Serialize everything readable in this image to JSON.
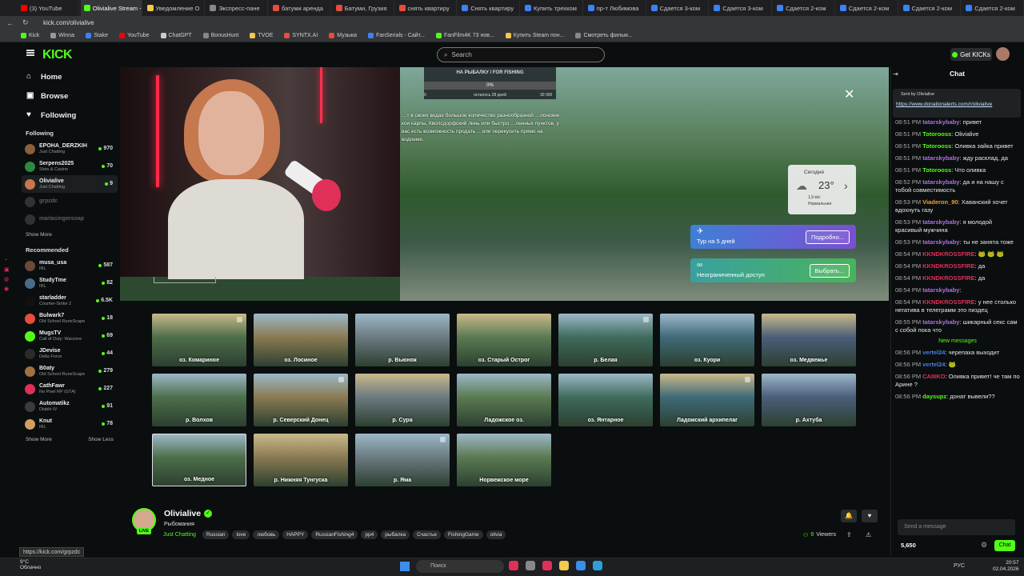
{
  "browser": {
    "tabs": [
      {
        "label": "(3) YouTube",
        "color": "#ff0000"
      },
      {
        "label": "Olivialive Stream - Wa",
        "color": "#53fc18",
        "active": true
      },
      {
        "label": "Уведомление О",
        "color": "#f2c94c"
      },
      {
        "label": "Экспресс-пане",
        "color": "#888888"
      },
      {
        "label": "батуми аренда",
        "color": "#e74c3c"
      },
      {
        "label": "Батуми, Грузия",
        "color": "#e74c3c"
      },
      {
        "label": "снять квартиру",
        "color": "#e74c3c"
      },
      {
        "label": "Снять квартиру",
        "color": "#3b82f6"
      },
      {
        "label": "Купить трехком",
        "color": "#3b82f6"
      },
      {
        "label": "пр-т Любимова",
        "color": "#3b82f6"
      },
      {
        "label": "Сдается 3-ком",
        "color": "#3b82f6"
      },
      {
        "label": "Сдается 3-ком",
        "color": "#3b82f6"
      },
      {
        "label": "Сдается 2-ком",
        "color": "#3b82f6"
      },
      {
        "label": "Сдается 2-ком",
        "color": "#3b82f6"
      },
      {
        "label": "Сдается 2-ком",
        "color": "#3b82f6"
      },
      {
        "label": "Сдается 2-ком",
        "color": "#3b82f6"
      }
    ],
    "url": "kick.com/olivialive",
    "bookmarks": [
      {
        "label": "Kick",
        "color": "#53fc18"
      },
      {
        "label": "Winna",
        "color": "#999999"
      },
      {
        "label": "Stake",
        "color": "#3b82f6"
      },
      {
        "label": "YouTube",
        "color": "#ff0000"
      },
      {
        "label": "ChatGPT",
        "color": "#cccccc"
      },
      {
        "label": "BonusHunt",
        "color": "#888888"
      },
      {
        "label": "TVOE",
        "color": "#f2c94c"
      },
      {
        "label": "SYNTX.AI",
        "color": "#e74c3c"
      },
      {
        "label": "Музыка",
        "color": "#e74c3c"
      },
      {
        "label": "FanSerials - Сайт...",
        "color": "#3b82f6"
      },
      {
        "label": "FanFilm4K 73 нов...",
        "color": "#53fc18"
      },
      {
        "label": "Купить Steam пон...",
        "color": "#f2c94c"
      },
      {
        "label": "Смотреть фильм...",
        "color": "#888888"
      }
    ],
    "hover_url": "https://kick.com/grpzdc"
  },
  "header": {
    "logo": "KICK",
    "search_placeholder": "Search",
    "get_kicks": "Get KICKs"
  },
  "sidebar": {
    "nav": [
      {
        "label": "Home",
        "icon": "⌂"
      },
      {
        "label": "Browse",
        "icon": "▣"
      },
      {
        "label": "Following",
        "icon": "♥"
      }
    ],
    "following_title": "Following",
    "following": [
      {
        "name": "EPOHA_DERZKIH",
        "cat": "Just Chatting",
        "viewers": "970",
        "color": "#8b5e3c"
      },
      {
        "name": "Serpens2025",
        "cat": "Slots & Casino",
        "viewers": "70",
        "color": "#2d8a3e"
      },
      {
        "name": "Olivialive",
        "cat": "Just Chatting",
        "viewers": "9",
        "color": "#c6784e"
      },
      {
        "name": "grpzdc",
        "cat": "",
        "viewers": "",
        "color": "#777777"
      },
      {
        "name": "marlasingersoap",
        "cat": "",
        "viewers": "",
        "color": "#777777"
      }
    ],
    "show_more": "Show More",
    "recommended_title": "Recommended",
    "recommended": [
      {
        "name": "musa_usa",
        "cat": "IRL",
        "viewers": "587",
        "color": "#6b4a3a"
      },
      {
        "name": "StudyTme",
        "cat": "IRL",
        "viewers": "82",
        "color": "#4a6b8a"
      },
      {
        "name": "starladder",
        "cat": "Counter-Strike 2",
        "viewers": "6.5K",
        "color": "#111111"
      },
      {
        "name": "Bulwark7",
        "cat": "Old School RuneScape",
        "viewers": "18",
        "color": "#e74c3c"
      },
      {
        "name": "MugsTV",
        "cat": "Call of Duty: Warzone",
        "viewers": "69",
        "color": "#53fc18"
      },
      {
        "name": "JDevise",
        "cat": "Delta Force",
        "viewers": "44",
        "color": "#2b2b2b"
      },
      {
        "name": "B0aty",
        "cat": "Old School RuneScape",
        "viewers": "279",
        "color": "#a07040"
      },
      {
        "name": "CathFawr",
        "cat": "No Pixel RP (GTA)",
        "viewers": "227",
        "color": "#e0305a"
      },
      {
        "name": "Automatikz",
        "cat": "Diablo IV",
        "viewers": "91",
        "color": "#3b3b3b"
      },
      {
        "name": "Knut",
        "cat": "IRL",
        "viewers": "78",
        "color": "#d0a060"
      }
    ],
    "show_more2": "Show More",
    "show_less": "Show Less"
  },
  "stream": {
    "progress_title": "НА РЫБАЛКУ / FOR FISHING",
    "progress_pct": "0%",
    "progress_left": "осталось 28 дней",
    "progress_min": "0",
    "progress_max": "30 000",
    "game_text": "…т в своих водах большое количество разнообразной …понские кои карпы, Кволсдорфский линь или быстро …ленных пунктов, у вас есть возможность продать …или перекусить прямо на водоеме.",
    "weather": {
      "day": "Сегодня",
      "temp": "23°",
      "wind": "1,9 м/с",
      "pressure": "Нормальная"
    },
    "promo1": {
      "text": "Тур на 5 дней",
      "button": "Подробно..."
    },
    "promo2": {
      "text": "Неограниченный доступ",
      "button": "Выбрать..."
    },
    "locations": [
      "оз. Комариное",
      "оз. Лосиное",
      "р. Вьюнок",
      "оз. Старый Острог",
      "р. Белая",
      "оз. Куори",
      "оз. Медвежье",
      "р. Волхов",
      "р. Северский Донец",
      "р. Сура",
      "Ладожское оз.",
      "оз. Янтарное",
      "Ладожский архипелаг",
      "р. Ахтуба",
      "оз. Медное",
      "р. Нижняя Тунгуска",
      "р. Яма",
      "Норвежское море"
    ]
  },
  "info": {
    "streamer": "Olivialive",
    "title": "Рыбомания",
    "category": "Just Chatting",
    "tags": [
      "Russian",
      "love",
      "любовь",
      "HAPPY",
      "RussianFishing4",
      "pp4",
      "рыбалка",
      "Счастье",
      "FishingGame",
      "olivia"
    ],
    "viewers_count": "9",
    "viewers_label": "Viewers",
    "live": "LIVE"
  },
  "chat": {
    "title": "Chat",
    "pinned_sender": "Sent by Olivialive",
    "pinned_link": "https://www.donationalerts.com/r/olivialive",
    "messages": [
      {
        "time": "08:51 PM",
        "user": "tatarskybaby",
        "color": "#b070e0",
        "text": "привет"
      },
      {
        "time": "08:51 PM",
        "user": "Totorooss",
        "color": "#53fc18",
        "text": "Olivialive"
      },
      {
        "time": "08:51 PM",
        "user": "Totorooss",
        "color": "#53fc18",
        "text": "Оливка зайка привет"
      },
      {
        "time": "08:51 PM",
        "user": "tatarskybaby",
        "color": "#b070e0",
        "text": "жду расклад, да"
      },
      {
        "time": "08:51 PM",
        "user": "Totorooss",
        "color": "#53fc18",
        "text": "Что оливка"
      },
      {
        "time": "08:52 PM",
        "user": "tatarskybaby",
        "color": "#b070e0",
        "text": "да и на нашу с тобой совместимость"
      },
      {
        "time": "08:53 PM",
        "user": "Viaderon_90",
        "color": "#f0a030",
        "text": "Хаванский хочет вдохнуть газу"
      },
      {
        "time": "08:53 PM",
        "user": "tatarskybaby",
        "color": "#b070e0",
        "text": "я молодой красивый мужчина"
      },
      {
        "time": "08:53 PM",
        "user": "tatarskybaby",
        "color": "#b070e0",
        "text": "ты не занята тоже"
      },
      {
        "time": "08:54 PM",
        "user": "KKNDKROSSFIRE",
        "color": "#e0305a",
        "text": "🐸 🐸 🐸"
      },
      {
        "time": "08:54 PM",
        "user": "KKNDKROSSFIRE",
        "color": "#e0305a",
        "text": "да"
      },
      {
        "time": "08:54 PM",
        "user": "KKNDKROSSFIRE",
        "color": "#e0305a",
        "text": "да"
      },
      {
        "time": "08:54 PM",
        "user": "tatarskybaby",
        "color": "#b070e0",
        "text": ""
      },
      {
        "time": "08:54 PM",
        "user": "KKNDKROSSFIRE",
        "color": "#e0305a",
        "text": "у нее столько негатива в телеграмм это пиздец"
      },
      {
        "time": "08:55 PM",
        "user": "tatarskybaby",
        "color": "#b070e0",
        "text": "шикарный секс сам с собой пока что"
      }
    ],
    "new_messages": "New messages",
    "messages2": [
      {
        "time": "08:56 PM",
        "user": "vertel24",
        "color": "#4a7fe0",
        "text": "черепаха выходит"
      },
      {
        "time": "08:56 PM",
        "user": "vertel24",
        "color": "#4a7fe0",
        "text": "🐸"
      },
      {
        "time": "08:56 PM",
        "user": "CAIIIKO",
        "color": "#e0305a",
        "text": "Оливка привет! че там по Арине ?"
      },
      {
        "time": "08:56 PM",
        "user": "daysupz",
        "color": "#53fc18",
        "text": "донат вывели??"
      }
    ],
    "send_placeholder": "Send a message",
    "kicks_balance": "5,650",
    "chat_button": "Chat"
  },
  "taskbar": {
    "temp": "9°C",
    "condition": "Облачно",
    "search": "Поиск",
    "lang": "РУС",
    "time": "20:57",
    "date": "02.04.2026"
  }
}
